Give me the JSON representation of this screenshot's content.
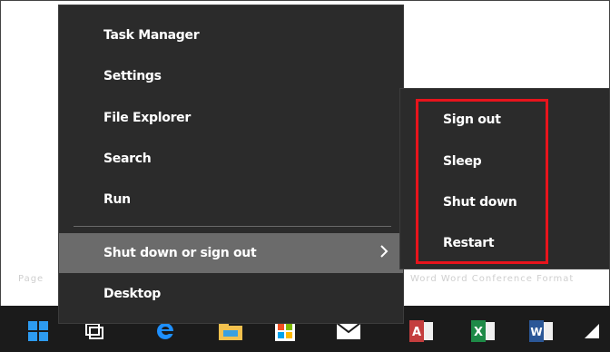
{
  "background_text": {
    "left": "Page",
    "right": "Word Word  Conference Format"
  },
  "menu": {
    "items": [
      {
        "label": "Task Manager"
      },
      {
        "label": "Settings"
      },
      {
        "label": "File Explorer"
      },
      {
        "label": "Search"
      },
      {
        "label": "Run"
      },
      {
        "label": "Shut down or sign out"
      },
      {
        "label": "Desktop"
      }
    ],
    "highlighted": "Shut down or sign out"
  },
  "submenu": {
    "items": [
      {
        "label": "Sign out"
      },
      {
        "label": "Sleep"
      },
      {
        "label": "Shut down"
      },
      {
        "label": "Restart"
      }
    ]
  },
  "taskbar": {
    "icons": [
      "windows-start-icon",
      "task-view-icon",
      "edge-icon",
      "file-explorer-icon",
      "store-icon",
      "mail-icon",
      "access-icon",
      "excel-icon",
      "word-icon",
      "app-icon"
    ],
    "letters": {
      "access": "A",
      "excel": "X",
      "word": "W"
    }
  },
  "colors": {
    "menu_bg": "#2b2b2b",
    "highlight": "#6b6b6b",
    "annotation": "#e8141c",
    "taskbar": "#1b1b1b"
  }
}
